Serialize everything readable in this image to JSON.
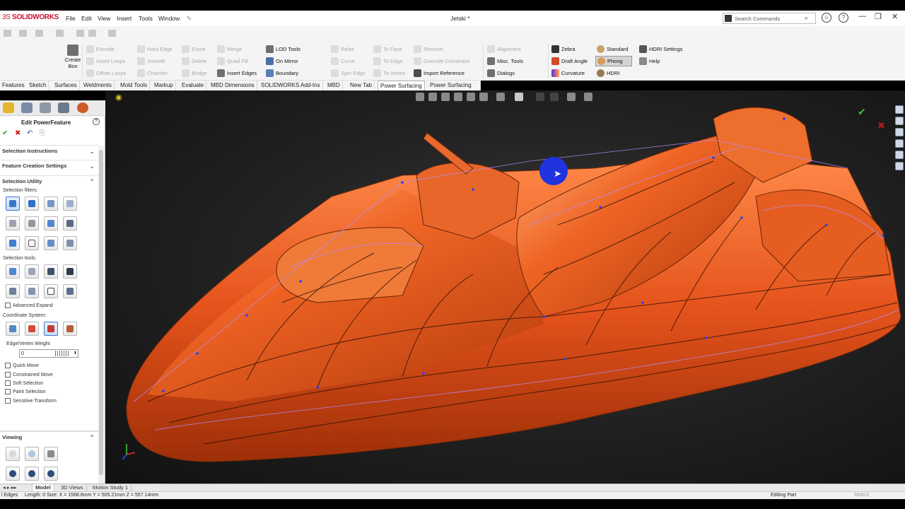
{
  "app": {
    "logo_text": "DS SOLIDWORKS",
    "logo_prefix": "3S",
    "logo_word": "SOLIDWORKS",
    "doc_title": "Jetski *"
  },
  "menu": [
    "File",
    "Edit",
    "View",
    "Insert",
    "Tools",
    "Window"
  ],
  "search": {
    "placeholder": "Search Commands"
  },
  "ribbon": {
    "create_box": "Create Box",
    "col1": [
      "Extrude",
      "Insert Loops",
      "Offset Loops"
    ],
    "col2": [
      "Hard Edge",
      "Smooth",
      "Chamfer"
    ],
    "col3": [
      "Erase",
      "Delete",
      "Bridge"
    ],
    "col4a": [
      "Merge",
      "Quad Fill"
    ],
    "insert_edges": "Insert Edges",
    "col5": [
      "LOD Tools",
      "On Mirror",
      "Boundary"
    ],
    "col6": [
      "Relax",
      "Curve",
      "Spin Edge"
    ],
    "col7": [
      "To Face",
      "To Edge",
      "To Vertex"
    ],
    "col8a": [
      "Remove",
      "Override Constraint"
    ],
    "import_reference": "Import Reference",
    "alignment": "Alignment",
    "col9": [
      "Misc. Tools",
      "Dialogs"
    ],
    "col10": [
      "Zebra",
      "Draft Angle",
      "Curvature"
    ],
    "col11": [
      "Standard",
      "Phong",
      "HDRI"
    ],
    "col12": [
      "HDRI Settings",
      "Help"
    ]
  },
  "tabs": [
    "Features",
    "Sketch",
    "Surfaces",
    "Weldments",
    "Mold Tools",
    "Markup",
    "Evaluate",
    "MBD Dimensions",
    "SOLIDWORKS Add-Ins",
    "MBD",
    "New Tab",
    "Power Surfacing",
    "Power Surfacing RE"
  ],
  "active_tab": "Power Surfacing",
  "panel": {
    "title": "Edit PowerFeature",
    "sections": {
      "selection_instructions": "Selection Instructions",
      "feature_creation": "Feature Creation Settings",
      "selection_utility": "Selection Utility",
      "viewing": "Viewing"
    },
    "labels": {
      "selection_filters": "Selection filters:",
      "selection_tools": "Selection tools:",
      "coordinate_system": "Coordinate System:",
      "edge_vertex_weight": "Edge/Vertex Weight"
    },
    "advanced_expand": "Advanced Expand",
    "weight_value": "0",
    "checkboxes": [
      "Quick Move",
      "Constrained Move",
      "Soft Selection",
      "Paint Selection",
      "Sensitive Transform"
    ]
  },
  "bottom_tabs": [
    "Model",
    "3D Views",
    "Motion Study 1"
  ],
  "status": {
    "left_prefix": "l Edges",
    "measure": "Length: 0 Size: X = 1568.8mm Y = 505.21mm Z = 557.14mm",
    "editing": "Editing Part",
    "units": "MMGS"
  },
  "colors": {
    "model_orange": "#e5531c",
    "edge_purple": "#b48cff",
    "accent_blue": "#1f33e0"
  }
}
